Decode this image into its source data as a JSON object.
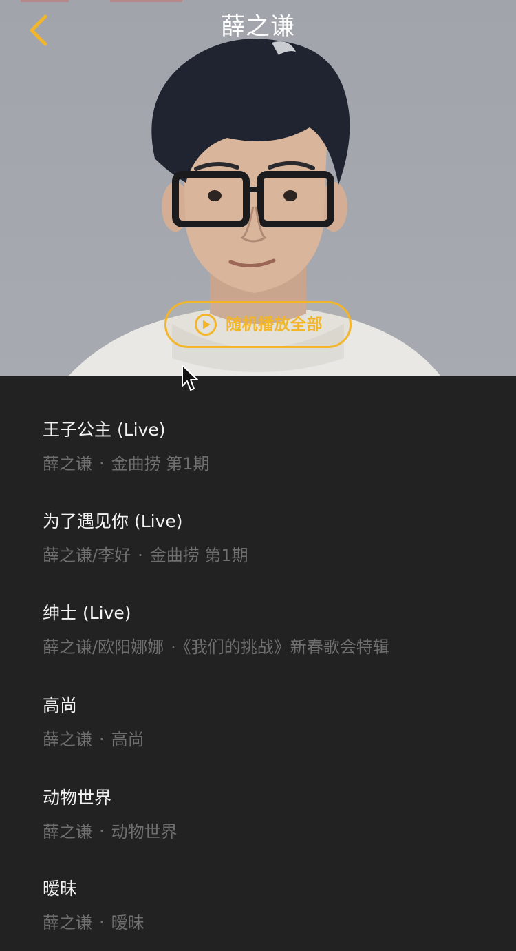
{
  "header": {
    "title": "薛之谦",
    "back_icon": "chevron-left-icon",
    "accent_color": "#f3b52a"
  },
  "hero": {
    "shuffle_label": "随机播放全部",
    "shuffle_icon": "play-circle-icon"
  },
  "songs": [
    {
      "title": "王子公主 (Live)",
      "artist": "薛之谦",
      "separator": "·",
      "album": "金曲捞 第1期"
    },
    {
      "title": "为了遇见你 (Live)",
      "artist": "薛之谦/李好",
      "separator": "·",
      "album": "金曲捞 第1期"
    },
    {
      "title": "绅士 (Live)",
      "artist": "薛之谦/欧阳娜娜",
      "separator": "·",
      "album": "《我们的挑战》新春歌会特辑"
    },
    {
      "title": "高尚",
      "artist": "薛之谦",
      "separator": "·",
      "album": "高尚"
    },
    {
      "title": "动物世界",
      "artist": "薛之谦",
      "separator": "·",
      "album": "动物世界"
    },
    {
      "title": "暧昧",
      "artist": "薛之谦",
      "separator": "·",
      "album": "暧昧"
    }
  ]
}
